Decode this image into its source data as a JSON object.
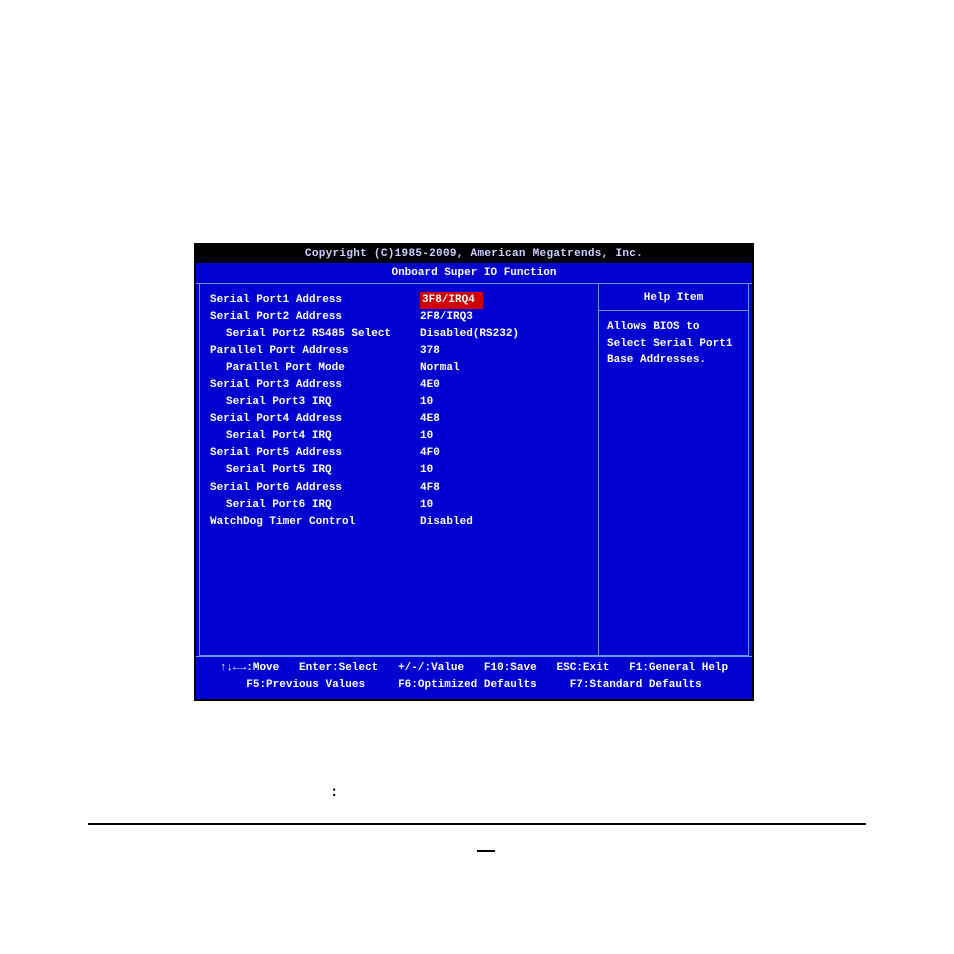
{
  "titlebar": "Copyright (C)1985-2009, American Megatrends, Inc.",
  "subtitle": "Onboard Super IO Function",
  "settings": [
    {
      "label": "Serial Port1 Address",
      "indent": false,
      "value": "3F8/IRQ4",
      "selected": true
    },
    {
      "label": "Serial Port2 Address",
      "indent": false,
      "value": "2F8/IRQ3",
      "selected": false
    },
    {
      "label": "Serial Port2 RS485 Select",
      "indent": true,
      "value": "Disabled(RS232)",
      "selected": false
    },
    {
      "label": "Parallel Port Address",
      "indent": false,
      "value": "378",
      "selected": false
    },
    {
      "label": "Parallel Port Mode",
      "indent": true,
      "value": "Normal",
      "selected": false
    },
    {
      "label": "Serial Port3 Address",
      "indent": false,
      "value": "4E0",
      "selected": false
    },
    {
      "label": "Serial Port3 IRQ",
      "indent": true,
      "value": "10",
      "selected": false
    },
    {
      "label": "Serial Port4 Address",
      "indent": false,
      "value": "4E8",
      "selected": false
    },
    {
      "label": "Serial Port4 IRQ",
      "indent": true,
      "value": "10",
      "selected": false
    },
    {
      "label": "Serial Port5 Address",
      "indent": false,
      "value": "4F0",
      "selected": false
    },
    {
      "label": "Serial Port5 IRQ",
      "indent": true,
      "value": "10",
      "selected": false
    },
    {
      "label": "Serial Port6 Address",
      "indent": false,
      "value": "4F8",
      "selected": false
    },
    {
      "label": "Serial Port6 IRQ",
      "indent": true,
      "value": "10",
      "selected": false
    },
    {
      "label": "WatchDog Timer Control",
      "indent": false,
      "value": "Disabled",
      "selected": false
    }
  ],
  "help": {
    "title": "Help Item",
    "body": "Allows BIOS to Select Serial Port1 Base Addresses."
  },
  "footer": {
    "line1": "↑↓←→:Move   Enter:Select   +/-/:Value   F10:Save   ESC:Exit   F1:General Help",
    "line2": "F5:Previous Values     F6:Optimized Defaults     F7:Standard Defaults"
  },
  "below": {
    "colon": ":"
  }
}
